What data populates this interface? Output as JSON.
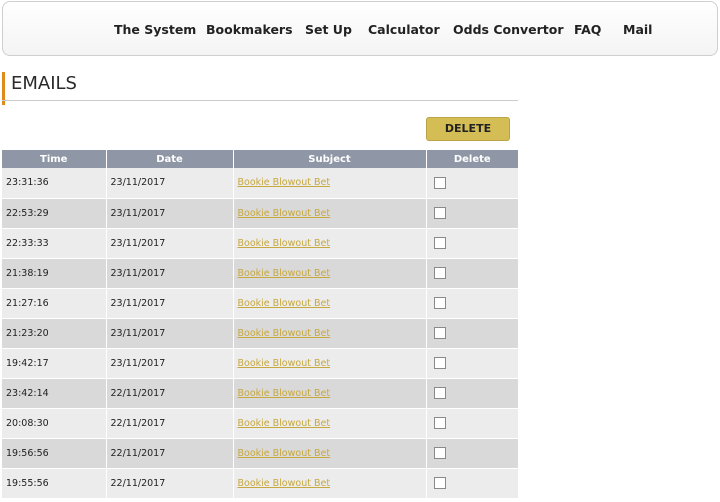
{
  "nav": {
    "items": [
      "The System",
      "Bookmakers",
      "Set Up",
      "Calculator",
      "Odds Convertor",
      "FAQ",
      "Mail"
    ]
  },
  "page": {
    "title": "EMAILS",
    "delete_button": "DELETE"
  },
  "table": {
    "columns": [
      "Time",
      "Date",
      "Subject",
      "Delete"
    ],
    "rows": [
      {
        "time": "23:31:36",
        "date": "23/11/2017",
        "subject": "Bookie Blowout Bet"
      },
      {
        "time": "22:53:29",
        "date": "23/11/2017",
        "subject": "Bookie Blowout Bet"
      },
      {
        "time": "22:33:33",
        "date": "23/11/2017",
        "subject": "Bookie Blowout Bet"
      },
      {
        "time": "21:38:19",
        "date": "23/11/2017",
        "subject": "Bookie Blowout Bet"
      },
      {
        "time": "21:27:16",
        "date": "23/11/2017",
        "subject": "Bookie Blowout Bet"
      },
      {
        "time": "21:23:20",
        "date": "23/11/2017",
        "subject": "Bookie Blowout Bet"
      },
      {
        "time": "19:42:17",
        "date": "23/11/2017",
        "subject": "Bookie Blowout Bet"
      },
      {
        "time": "23:42:14",
        "date": "22/11/2017",
        "subject": "Bookie Blowout Bet"
      },
      {
        "time": "20:08:30",
        "date": "22/11/2017",
        "subject": "Bookie Blowout Bet"
      },
      {
        "time": "19:56:56",
        "date": "22/11/2017",
        "subject": "Bookie Blowout Bet"
      },
      {
        "time": "19:55:56",
        "date": "22/11/2017",
        "subject": "Bookie Blowout Bet"
      }
    ]
  },
  "colors": {
    "accent": "#e08a1e",
    "button": "#d4bd55",
    "header": "#8f97a6",
    "link": "#c7a83f",
    "row_odd": "#ececec",
    "row_even": "#d9d9d9"
  }
}
